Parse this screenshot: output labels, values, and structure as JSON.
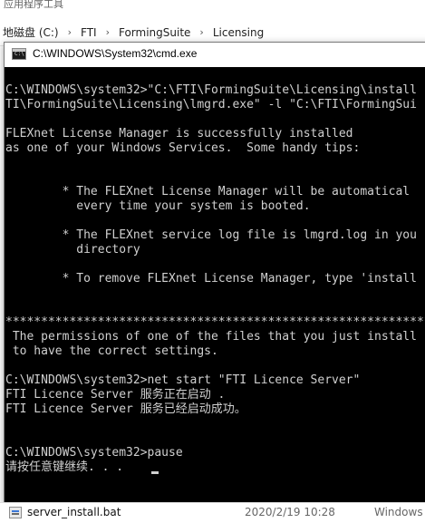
{
  "explorer": {
    "title_partial": "应用程序工具",
    "breadcrumbs": [
      "地磁盘 (C:)",
      "FTI",
      "FormingSuite",
      "Licensing"
    ],
    "breadcrumb_separator": "›",
    "file": {
      "name": "server_install.bat",
      "date": "2020/2/19 10:28",
      "type": "Windows"
    }
  },
  "cmd": {
    "title": "C:\\WINDOWS\\System32\\cmd.exe",
    "lines": [
      "C:\\WINDOWS\\system32>\"C:\\FTI\\FormingSuite\\Licensing\\install",
      "TI\\FormingSuite\\Licensing\\lmgrd.exe\" -l \"C:\\FTI\\FormingSui",
      "",
      "FLEXnet License Manager is successfully installed",
      "as one of your Windows Services.  Some handy tips:",
      "",
      "",
      "        * The FLEXnet License Manager will be automatical",
      "          every time your system is booted.",
      "",
      "        * The FLEXnet service log file is lmgrd.log in you",
      "          directory",
      "",
      "        * To remove FLEXnet License Manager, type 'install",
      "",
      "",
      "*************************************************************",
      " The permissions of one of the files that you just install",
      " to have the correct settings.",
      "",
      "C:\\WINDOWS\\system32>net start \"FTI Licence Server\"",
      "FTI Licence Server 服务正在启动 .",
      "FTI Licence Server 服务已经启动成功。",
      "",
      "",
      "C:\\WINDOWS\\system32>pause",
      "请按任意键继续. . . "
    ],
    "colors": {
      "background": "#000000",
      "text": "#d0d0d0"
    }
  }
}
